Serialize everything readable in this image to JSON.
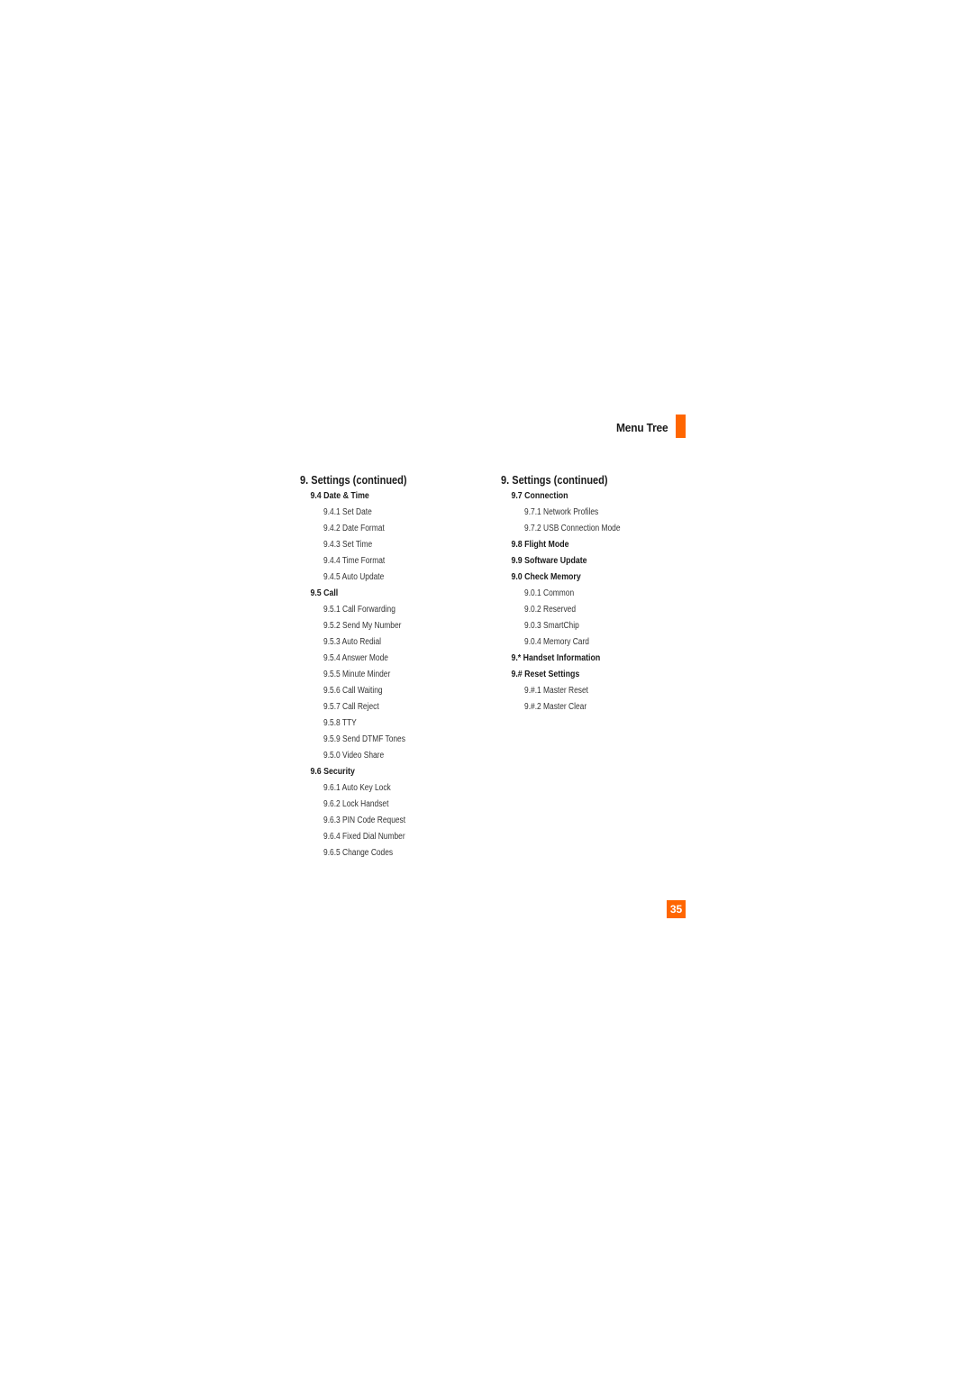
{
  "header": {
    "title": "Menu Tree",
    "accent_color": "#ff6600"
  },
  "left": {
    "title": "9. Settings (continued)",
    "groups": [
      {
        "label": "9.4 Date & Time",
        "items": [
          "9.4.1 Set Date",
          "9.4.2 Date Format",
          "9.4.3 Set Time",
          "9.4.4 Time Format",
          "9.4.5 Auto Update"
        ]
      },
      {
        "label": "9.5 Call",
        "items": [
          "9.5.1 Call Forwarding",
          "9.5.2 Send My Number",
          "9.5.3 Auto Redial",
          "9.5.4 Answer Mode",
          "9.5.5 Minute Minder",
          "9.5.6 Call Waiting",
          "9.5.7 Call Reject",
          "9.5.8 TTY",
          "9.5.9 Send DTMF Tones",
          "9.5.0 Video Share"
        ]
      },
      {
        "label": "9.6 Security",
        "items": [
          "9.6.1 Auto Key Lock",
          "9.6.2 Lock Handset",
          "9.6.3 PIN Code Request",
          "9.6.4 Fixed Dial Number",
          "9.6.5 Change Codes"
        ]
      }
    ]
  },
  "right": {
    "title": "9. Settings (continued)",
    "groups": [
      {
        "label": "9.7 Connection",
        "items": [
          "9.7.1 Network Profiles",
          "9.7.2 USB Connection Mode"
        ]
      },
      {
        "label": "9.8 Flight Mode",
        "items": []
      },
      {
        "label": "9.9 Software Update",
        "items": []
      },
      {
        "label": "9.0 Check Memory",
        "items": [
          "9.0.1 Common",
          "9.0.2 Reserved",
          "9.0.3 SmartChip",
          "9.0.4 Memory Card"
        ]
      },
      {
        "label": "9.* Handset Information",
        "items": []
      },
      {
        "label": "9.# Reset Settings",
        "items": [
          "9.#.1 Master Reset",
          "9.#.2 Master Clear"
        ]
      }
    ]
  },
  "page_number": "35"
}
